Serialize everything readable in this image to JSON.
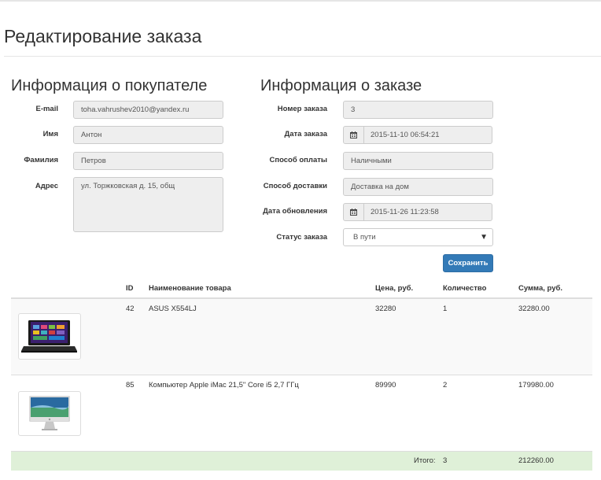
{
  "page": {
    "title": "Редактирование заказа"
  },
  "customer": {
    "section_title": "Информация о покупателе",
    "email_label": "E-mail",
    "email": "toha.vahrushev2010@yandex.ru",
    "first_name_label": "Имя",
    "first_name": "Антон",
    "last_name_label": "Фамилия",
    "last_name": "Петров",
    "address_label": "Адрес",
    "address": "ул. Торжковская д. 15, общ"
  },
  "order": {
    "section_title": "Информация о заказе",
    "number_label": "Номер заказа",
    "number": "3",
    "date_label": "Дата заказа",
    "date": "2015-11-10 06:54:21",
    "payment_label": "Способ оплаты",
    "payment": "Наличными",
    "delivery_label": "Способ доставки",
    "delivery": "Доставка на дом",
    "updated_label": "Дата обновления",
    "updated": "2015-11-26 11:23:58",
    "status_label": "Статус заказа",
    "status": "В пути",
    "save_label": "Сохранить"
  },
  "icons": {
    "calendar": "calendar-icon",
    "select_arrow": "caret-down-icon"
  },
  "table": {
    "headers": {
      "id": "ID",
      "name": "Наименование товара",
      "price": "Цена, руб.",
      "qty": "Количество",
      "sum": "Сумма, руб."
    },
    "rows": [
      {
        "id": "42",
        "name": "ASUS X554LJ",
        "price": "32280",
        "qty": "1",
        "sum": "32280.00",
        "image": "laptop"
      },
      {
        "id": "85",
        "name": "Компьютер Apple iMac 21,5\" Core i5 2,7 ГГц",
        "price": "89990",
        "qty": "2",
        "sum": "179980.00",
        "image": "imac"
      }
    ],
    "total": {
      "label": "Итого:",
      "qty": "3",
      "sum": "212260.00"
    }
  },
  "colors": {
    "primary": "#337ab7",
    "success_row": "#dff0d8"
  }
}
